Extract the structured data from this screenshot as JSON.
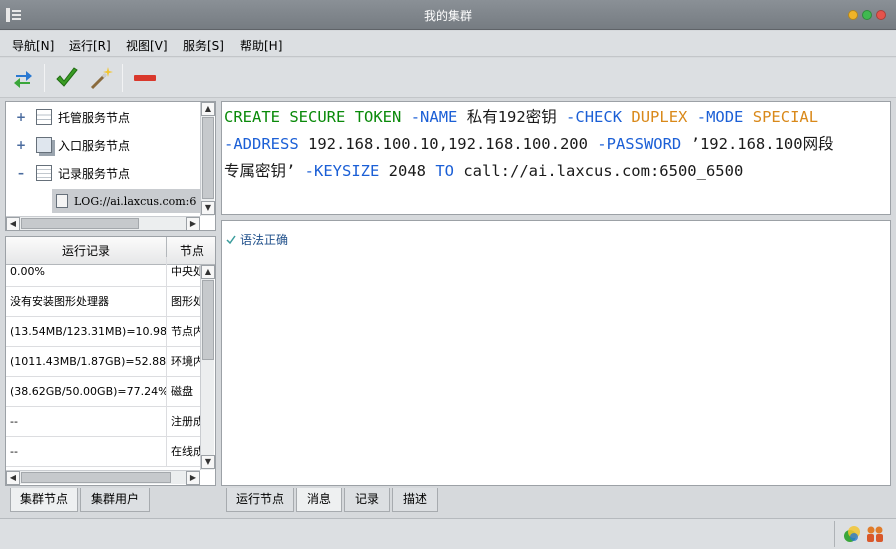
{
  "window": {
    "title": "我的集群"
  },
  "menu": [
    {
      "label": "导航[N]"
    },
    {
      "label": "运行[R]"
    },
    {
      "label": "视图[V]"
    },
    {
      "label": "服务[S]"
    },
    {
      "label": "帮助[H]"
    }
  ],
  "toolbar": {
    "refresh_icon": "refresh-icon",
    "check_icon": "checkmark-icon",
    "wand_icon": "magic-wand-icon",
    "remove_icon": "minus-icon"
  },
  "tree": {
    "items": [
      {
        "toggle": "+",
        "label": "托管服务节点",
        "icon": "storage-node-icon"
      },
      {
        "toggle": "+",
        "label": "入口服务节点",
        "icon": "entry-node-icon"
      },
      {
        "toggle": "–",
        "label": "记录服务节点",
        "icon": "log-node-icon"
      }
    ],
    "child": {
      "label": "LOG://ai.laxcus.com:6"
    }
  },
  "table": {
    "headers": [
      "运行记录",
      "节点"
    ],
    "rows": [
      [
        "0.00%",
        "中央处"
      ],
      [
        "没有安装图形处理器",
        "图形处"
      ],
      [
        "(13.54MB/123.31MB)=10.98%",
        "节点内"
      ],
      [
        "(1011.43MB/1.87GB)=52.88%",
        "环境内"
      ],
      [
        "(38.62GB/50.00GB)=77.24%",
        "磁盘"
      ],
      [
        "--",
        "注册成"
      ],
      [
        "--",
        "在线成"
      ]
    ]
  },
  "left_tabs": [
    "集群节点",
    "集群用户"
  ],
  "command": {
    "line1": [
      {
        "t": "CREATE",
        "c": "green"
      },
      {
        "t": " ",
        "c": "dark"
      },
      {
        "t": "SECURE",
        "c": "green"
      },
      {
        "t": " ",
        "c": "dark"
      },
      {
        "t": "TOKEN",
        "c": "green"
      },
      {
        "t": " ",
        "c": "dark"
      },
      {
        "t": "-NAME",
        "c": "blue"
      },
      {
        "t": " 私有192密钥 ",
        "c": "dark"
      },
      {
        "t": "-CHECK",
        "c": "blue"
      },
      {
        "t": " ",
        "c": "dark"
      },
      {
        "t": "DUPLEX",
        "c": "orange"
      },
      {
        "t": " ",
        "c": "dark"
      },
      {
        "t": "-MODE",
        "c": "blue"
      },
      {
        "t": " ",
        "c": "dark"
      },
      {
        "t": "SPECIAL",
        "c": "orange"
      }
    ],
    "line2": [
      {
        "t": "-ADDRESS",
        "c": "blue"
      },
      {
        "t": " 192.168.100.10,192.168.100.200 ",
        "c": "dark"
      },
      {
        "t": "-PASSWORD",
        "c": "blue"
      },
      {
        "t": " ’192.168.100网段",
        "c": "dark"
      }
    ],
    "line3": [
      {
        "t": "专属密钥’ ",
        "c": "dark"
      },
      {
        "t": "-KEYSIZE",
        "c": "blue"
      },
      {
        "t": " 2048 ",
        "c": "dark"
      },
      {
        "t": "TO",
        "c": "blue"
      },
      {
        "t": " call://ai.laxcus.com:6500_6500",
        "c": "dark"
      }
    ]
  },
  "result": {
    "icon": "check-icon",
    "text": "语法正确"
  },
  "bottom_tabs": [
    "运行节点",
    "消息",
    "记录",
    "描述"
  ],
  "colors": {
    "keyword_green": "#0a8a0a",
    "keyword_blue": "#1b5fd6",
    "keyword_orange": "#d9891a",
    "result_text": "#1f4f8a"
  }
}
